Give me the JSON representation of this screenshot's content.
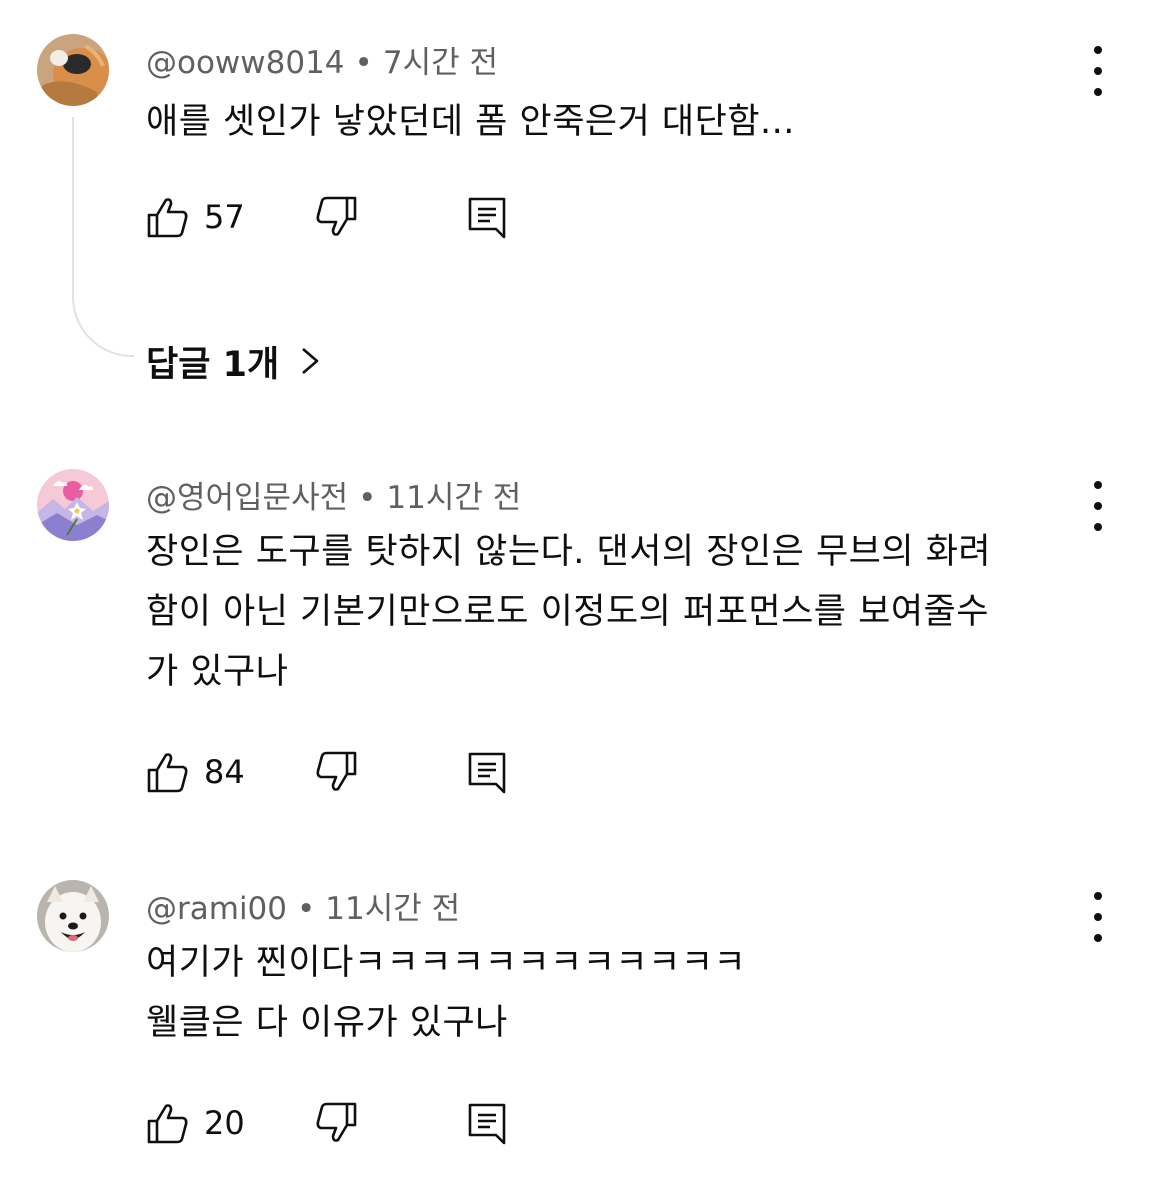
{
  "comments": [
    {
      "author": "@ooww8014",
      "time": "7시간 전",
      "lines": [
        "애를 셋인가 낳았던데 폼 안죽은거 대단함..."
      ],
      "likes": "57",
      "replies_label": "답글 1개",
      "avatar_icon": "cat-photo-avatar"
    },
    {
      "author": "@영어입문사전",
      "time": "11시간 전",
      "lines": [
        "장인은 도구를 탓하지 않는다. 댄서의 장인은 무브의 화려",
        "함이 아닌 기본기만으로도 이정도의 퍼포먼스를 보여줄수",
        "가 있구나"
      ],
      "likes": "84",
      "avatar_icon": "mountain-flower-avatar"
    },
    {
      "author": "@rami00",
      "time": "11시간 전",
      "lines": [
        "여기가 찐이다ㅋㅋㅋㅋㅋㅋㅋㅋㅋㅋㅋㅋ",
        "웰클은 다 이유가 있구나"
      ],
      "likes": "20",
      "avatar_icon": "dog-photo-avatar"
    }
  ],
  "separator": "•",
  "colors": {
    "text": "#0f0f0f",
    "meta": "#606060",
    "thread_line": "#e2e2e2"
  }
}
